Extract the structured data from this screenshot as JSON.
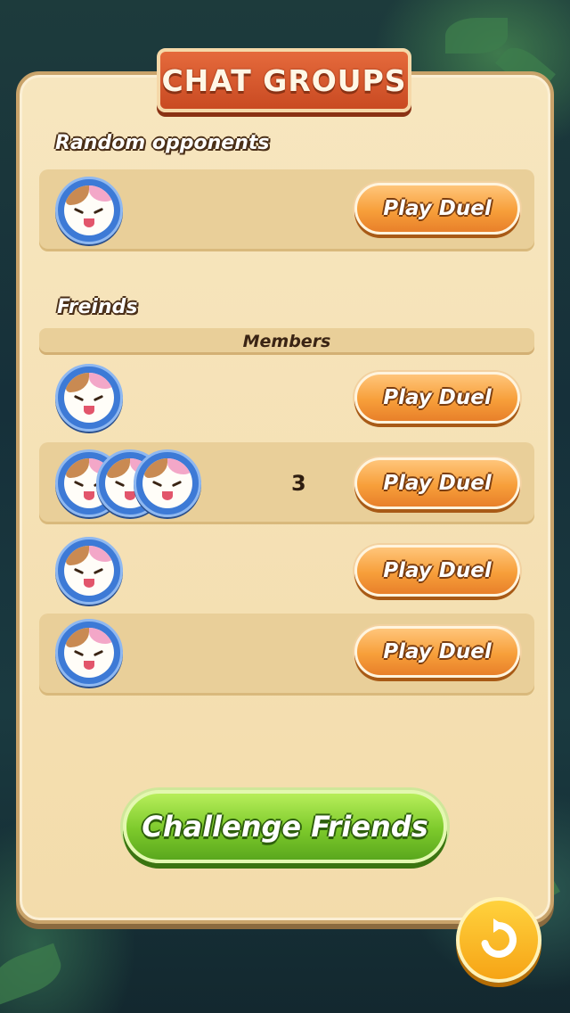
{
  "title": "CHAT GROUPS",
  "random_section": {
    "label": "Random opponents",
    "button_label": "Play Duel"
  },
  "friends_section": {
    "label": "Freinds",
    "members_header": "Members",
    "rows": [
      {
        "member_count": "",
        "button_label": "Play Duel"
      },
      {
        "member_count": "3",
        "button_label": "Play Duel"
      },
      {
        "member_count": "",
        "button_label": "Play Duel"
      },
      {
        "member_count": "",
        "button_label": "Play Duel"
      }
    ]
  },
  "challenge_button": "Challenge Friends",
  "icons": {
    "avatar": "cat-avatar-icon",
    "refresh": "refresh-icon"
  },
  "colors": {
    "panel": "#f3dcab",
    "banner": "#d9572c",
    "duel_button": "#f79f3a",
    "challenge_button": "#7cc92b",
    "refresh_button": "#f6a416",
    "avatar_ring": "#3d7ad6"
  }
}
